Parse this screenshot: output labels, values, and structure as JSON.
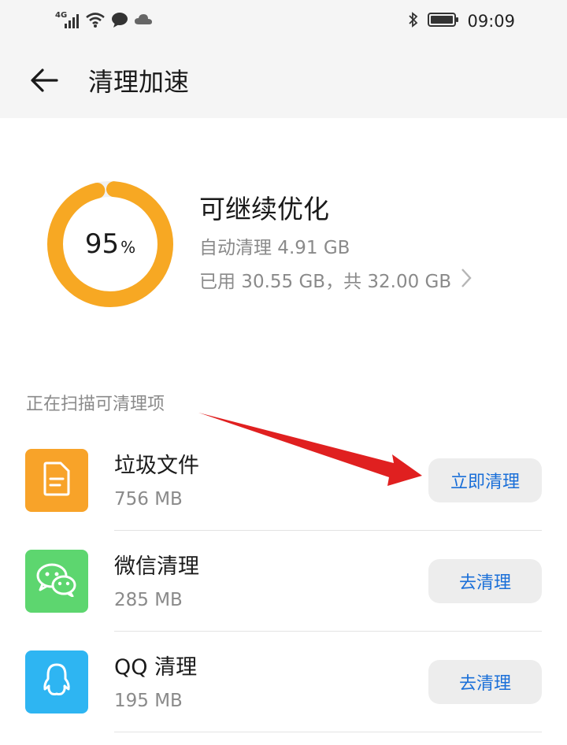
{
  "status_bar": {
    "network": "4G",
    "time": "09:09",
    "icons": [
      "signal-icon",
      "wifi-icon",
      "message-icon",
      "cloud-icon",
      "bluetooth-icon",
      "battery-icon"
    ]
  },
  "header": {
    "title": "清理加速",
    "back_icon": "back-arrow-icon"
  },
  "storage": {
    "percent": "95",
    "percent_sign": "%",
    "percent_value": 95,
    "status": "可继续优化",
    "auto_clean": "自动清理 4.91 GB",
    "usage": "已用 30.55 GB，共 32.00 GB",
    "ring_color": "#f7a823"
  },
  "scan": {
    "label": "正在扫描可清理项"
  },
  "items": [
    {
      "name": "垃圾文件",
      "size": "756 MB",
      "button": "立即清理",
      "icon": "file-icon",
      "icon_color": "#f8a329"
    },
    {
      "name": "微信清理",
      "size": "285 MB",
      "button": "去清理",
      "icon": "wechat-icon",
      "icon_color": "#5dd66f"
    },
    {
      "name": "QQ 清理",
      "size": "195 MB",
      "button": "去清理",
      "icon": "qq-icon",
      "icon_color": "#2eb5f2"
    }
  ],
  "colors": {
    "button_text": "#1a6fd8",
    "annotation_arrow": "#e02020"
  }
}
